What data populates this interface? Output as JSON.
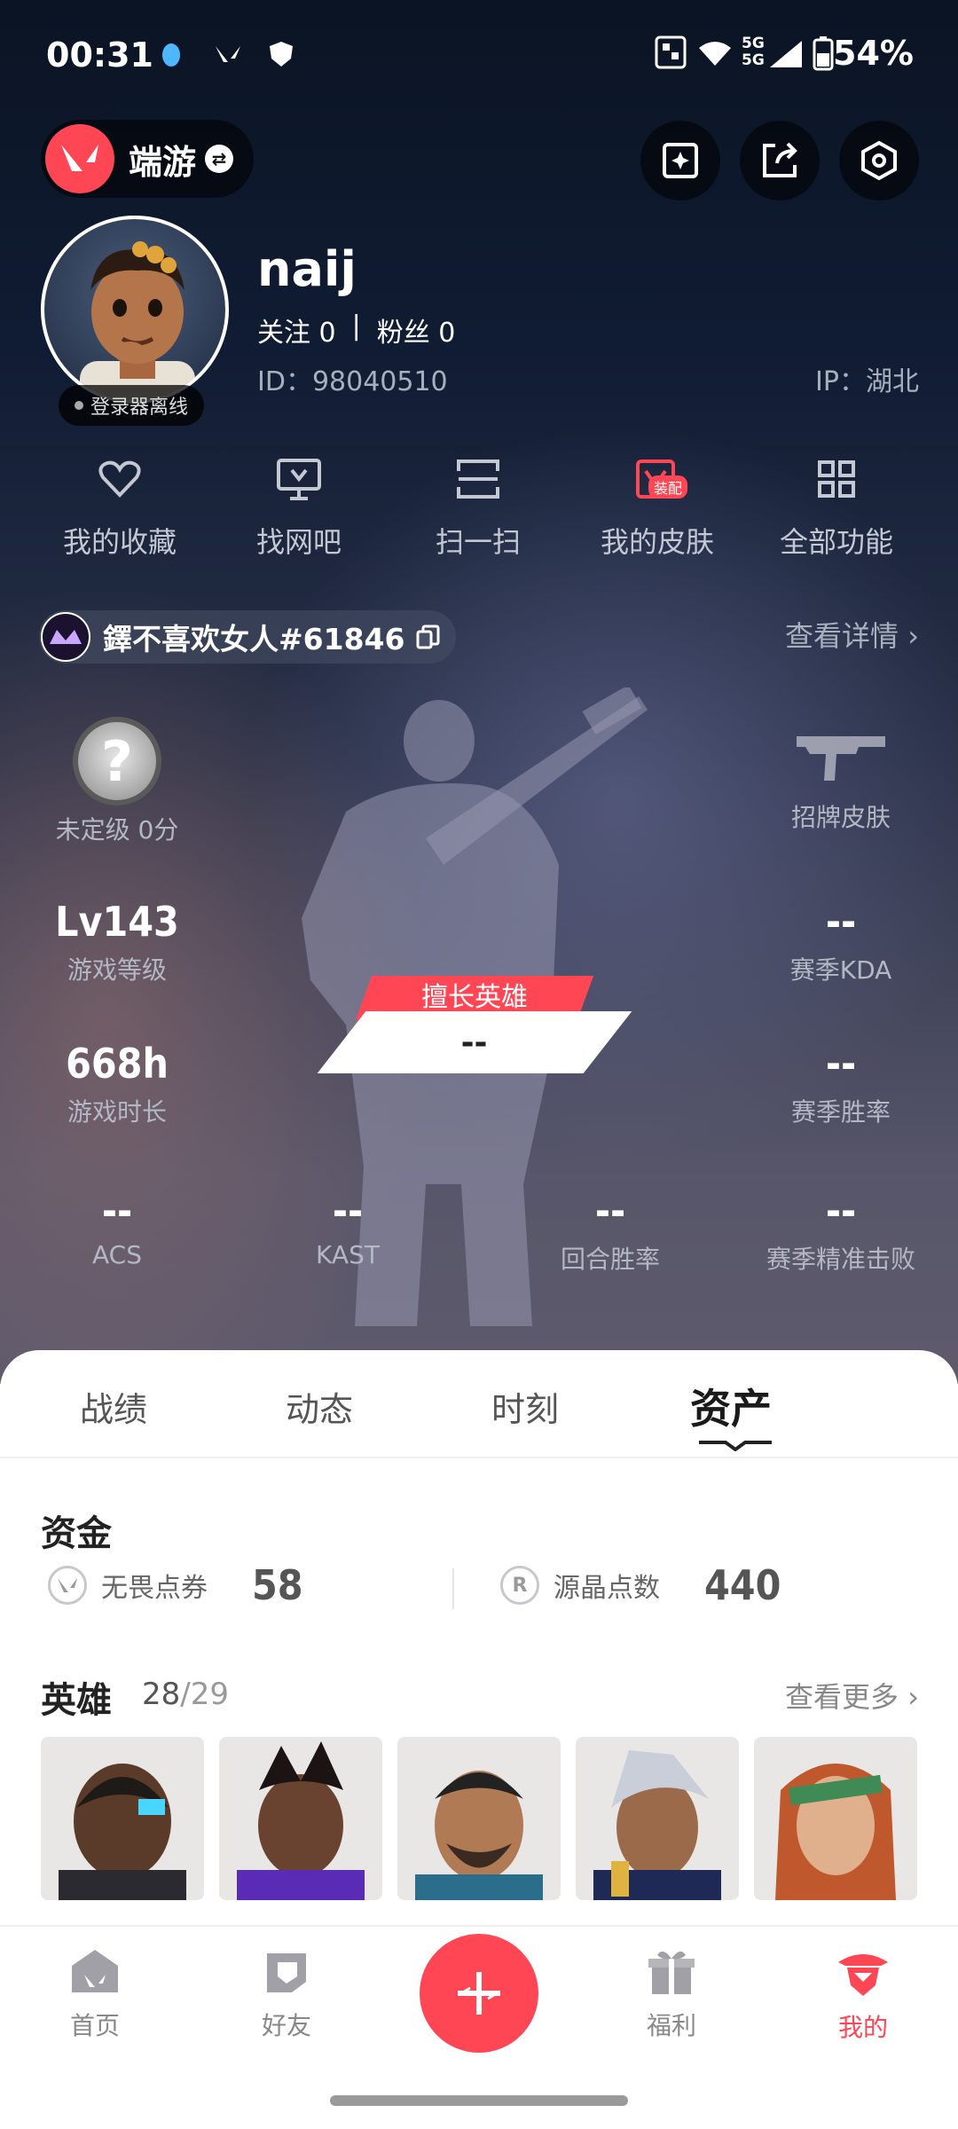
{
  "status_bar": {
    "time": "00:31",
    "battery": "54%",
    "network": "5G"
  },
  "header": {
    "game_label": "端游",
    "icons": [
      "share-card-icon",
      "export-icon",
      "settings-icon"
    ]
  },
  "profile": {
    "nickname": "naij",
    "follow_label": "关注",
    "follow_count": "0",
    "separator": "|",
    "fans_label": "粉丝",
    "fans_count": "0",
    "id_text": "ID：98040510",
    "ip_text": "IP：湖北",
    "offline_text": "登录器离线"
  },
  "quick_menu": [
    {
      "label": "我的收藏",
      "icon": "heart-icon"
    },
    {
      "label": "找网吧",
      "icon": "monitor-icon"
    },
    {
      "label": "扫一扫",
      "icon": "scan-icon"
    },
    {
      "label": "我的皮肤",
      "icon": "skin-icon",
      "badge": "装配"
    },
    {
      "label": "全部功能",
      "icon": "grid-icon"
    }
  ],
  "riot_account": {
    "name": "鐸不喜欢女人#61846",
    "view_detail": "查看详情"
  },
  "stats": {
    "rank": {
      "value": "?",
      "label": "未定级 0分"
    },
    "level": {
      "value": "Lv143",
      "label": "游戏等级"
    },
    "playtime": {
      "value": "668h",
      "label": "游戏时长"
    },
    "skin": {
      "label": "招牌皮肤"
    },
    "kda": {
      "value": "--",
      "label": "赛季KDA"
    },
    "season_win": {
      "value": "--",
      "label": "赛季胜率"
    },
    "best_agent": {
      "tag": "擅长英雄",
      "value": "--"
    },
    "acs": {
      "value": "--",
      "label": "ACS"
    },
    "kast": {
      "value": "--",
      "label": "KAST"
    },
    "round_win": {
      "value": "--",
      "label": "回合胜率"
    },
    "headshot": {
      "value": "--",
      "label": "赛季精准击败"
    }
  },
  "tabs": [
    {
      "label": "战绩",
      "active": false
    },
    {
      "label": "动态",
      "active": false
    },
    {
      "label": "时刻",
      "active": false
    },
    {
      "label": "资产",
      "active": true
    }
  ],
  "funds": {
    "title": "资金",
    "items": [
      {
        "icon": "valorant-points-icon",
        "label": "无畏点券",
        "value": "58"
      },
      {
        "icon": "radianite-icon",
        "label": "源晶点数",
        "value": "440"
      }
    ]
  },
  "agents": {
    "title": "英雄",
    "owned": "28",
    "slash": "/",
    "total": "29",
    "see_more": "查看更多",
    "portraits": [
      "agent-portrait-1",
      "agent-portrait-2",
      "agent-portrait-3",
      "agent-portrait-4",
      "agent-portrait-5"
    ]
  },
  "bottom_nav": [
    {
      "label": "首页",
      "icon": "home-icon",
      "active": false
    },
    {
      "label": "好友",
      "icon": "friends-icon",
      "active": false
    },
    {
      "label": "福利",
      "icon": "gift-icon",
      "active": false
    },
    {
      "label": "我的",
      "icon": "profile-icon",
      "active": true
    }
  ],
  "colors": {
    "accent": "#ff4655",
    "hero_bg": "#101c33",
    "sheet_bg": "#ffffff"
  }
}
